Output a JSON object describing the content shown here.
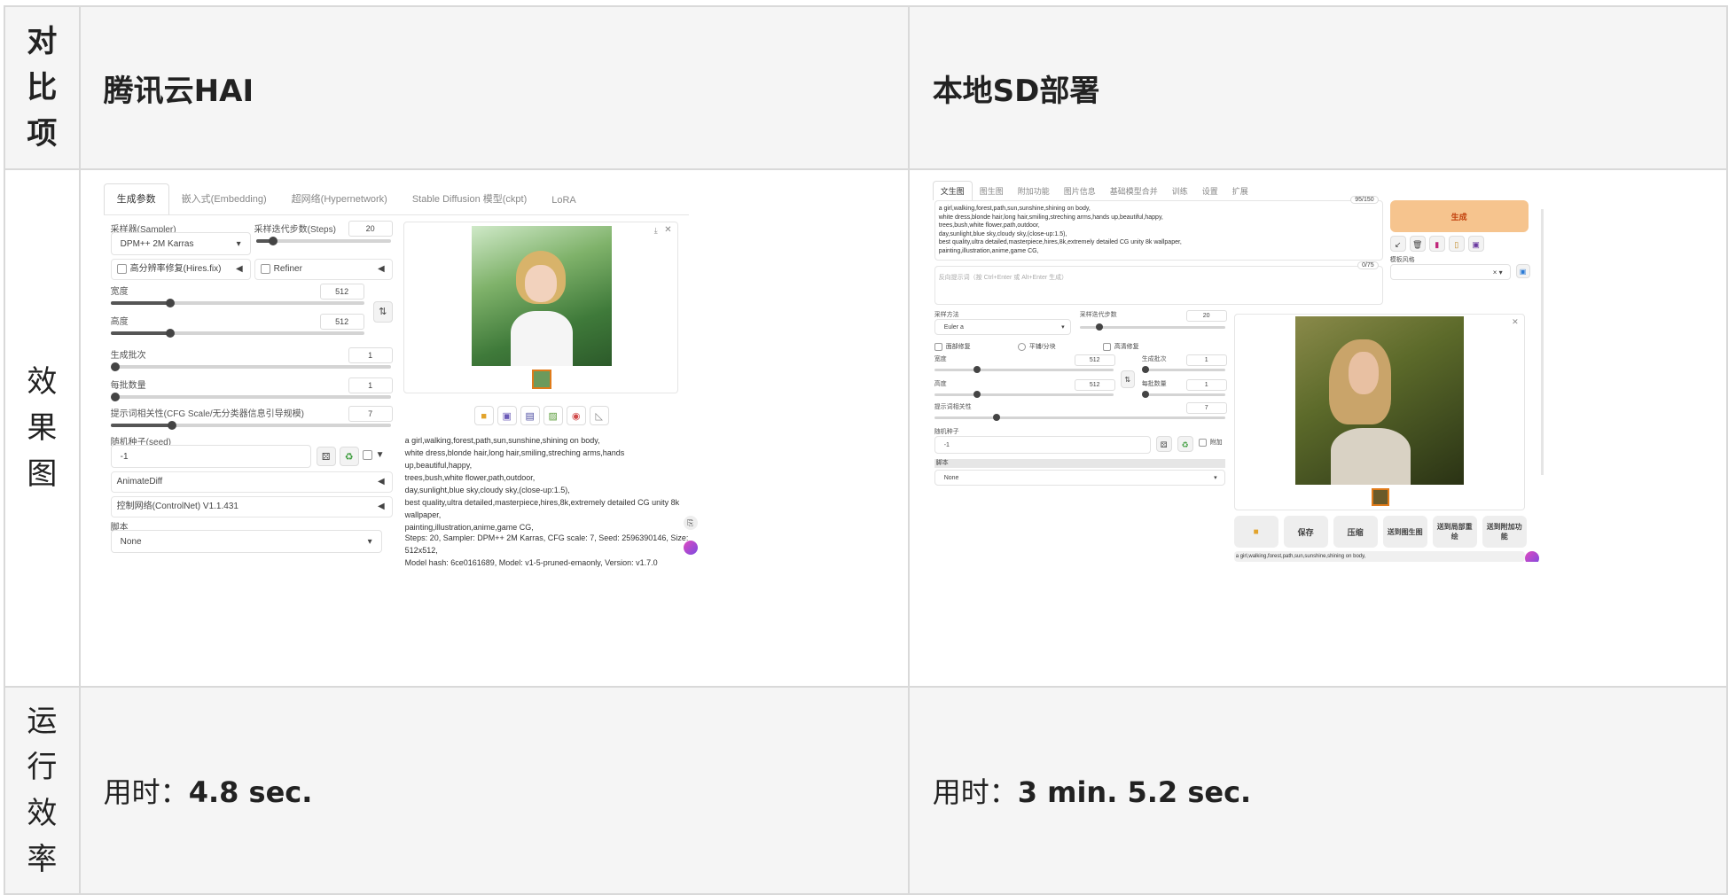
{
  "table": {
    "header": {
      "item": "对比项",
      "col1": "腾讯云HAI",
      "col2": "本地SD部署"
    },
    "rows": {
      "effect": {
        "label": "效果图"
      },
      "runtime": {
        "label": "运行效率",
        "col1_prefix": "用时：",
        "col1_value": "4.8 sec.",
        "col2_prefix": "用时：",
        "col2_value": "3 min. 5.2 sec."
      }
    }
  },
  "hai": {
    "tabs": [
      "生成参数",
      "嵌入式(Embedding)",
      "超网络(Hypernetwork)",
      "Stable Diffusion 模型(ckpt)",
      "LoRA"
    ],
    "sampler_label": "采样器(Sampler)",
    "sampler_value": "DPM++ 2M Karras",
    "steps_label": "采样迭代步数(Steps)",
    "steps_value": "20",
    "hires_label": "高分辨率修复(Hires.fix)",
    "refiner_label": "Refiner",
    "width_label": "宽度",
    "width_value": "512",
    "height_label": "高度",
    "height_value": "512",
    "batch_count_label": "生成批次",
    "batch_count_value": "1",
    "batch_size_label": "每批数量",
    "batch_size_value": "1",
    "cfg_label": "提示词相关性(CFG Scale/无分类器信息引导规模)",
    "cfg_value": "7",
    "seed_label": "随机种子(seed)",
    "seed_value": "-1",
    "animatediff_label": "AnimateDiff",
    "controlnet_label": "控制网络(ControlNet) V1.1.431",
    "script_label": "脚本",
    "script_value": "None",
    "prompt_text": "a girl,walking,forest,path,sun,sunshine,shining on body,\nwhite dress,blonde hair,long hair,smiling,streching arms,hands up,beautiful,happy,\ntrees,bush,white flower,path,outdoor,\nday,sunlight,blue sky,cloudy sky,(close-up:1.5),\nbest quality,ultra detailed,masterpiece,hires,8k,extremely detailed CG unity 8k\nwallpaper,\npainting,illustration,anime,game CG,",
    "info_text": "Steps: 20, Sampler: DPM++ 2M Karras, CFG scale: 7, Seed: 2596390146, Size: 512x512,\nModel hash: 6ce0161689, Model: v1-5-pruned-emaonly, Version: v1.7.0",
    "swap_icon": "swap-arrows-icon"
  },
  "local": {
    "tabs": [
      "文生图",
      "图生图",
      "附加功能",
      "图片信息",
      "基础模型合并",
      "训练",
      "设置",
      "扩展"
    ],
    "prompt_text": "a girl,walking,forest,path,sun,sunshine,shining on body,\nwhite dress,blonde hair,long hair,smiling,streching arms,hands up,beautiful,happy,\ntrees,bush,white flower,path,outdoor,\nday,sunlight,blue sky,cloudy sky,(close-up:1.5),\nbest quality,ultra detailed,masterpiece,hires,8k,extremely detailed CG unity 8k wallpaper,\npainting,illustration,anime,game CG,",
    "prompt_counter": "95/150",
    "neg_placeholder": "反向提示词（按 Ctrl+Enter 或 Alt+Enter 生成）",
    "neg_counter": "0/75",
    "generate_label": "生成",
    "style_label": "模板风格",
    "sampler_label": "采样方法",
    "sampler_value": "Euler a",
    "steps_label": "采样迭代步数",
    "steps_value": "20",
    "face_restore": "面部修复",
    "tiling": "平铺/分块",
    "hires": "高清修复",
    "width_label": "宽度",
    "width_value": "512",
    "height_label": "高度",
    "height_value": "512",
    "batch_count_label": "生成批次",
    "batch_count_value": "1",
    "batch_size_label": "每批数量",
    "batch_size_value": "1",
    "cfg_label": "提示词相关性",
    "cfg_value": "7",
    "seed_label": "随机种子",
    "seed_value": "-1",
    "extra_label": "附加",
    "script_label": "脚本",
    "script_value": "None",
    "gallery_buttons": [
      "保存",
      "压缩",
      "送到图生图",
      "送到局部重绘",
      "送到附加功能"
    ],
    "result_text": "a girl,walking,forest,path,sun,sunshine,shining on body,\nwhite dress,blonde hair,long hair,smiling,streching arms,hands up,beautiful,happy,"
  },
  "colors": {
    "generate": "#f6c48e",
    "generate_text": "#c2410c",
    "header_bg": "#f5f5f5",
    "border": "#d9d9d9"
  }
}
